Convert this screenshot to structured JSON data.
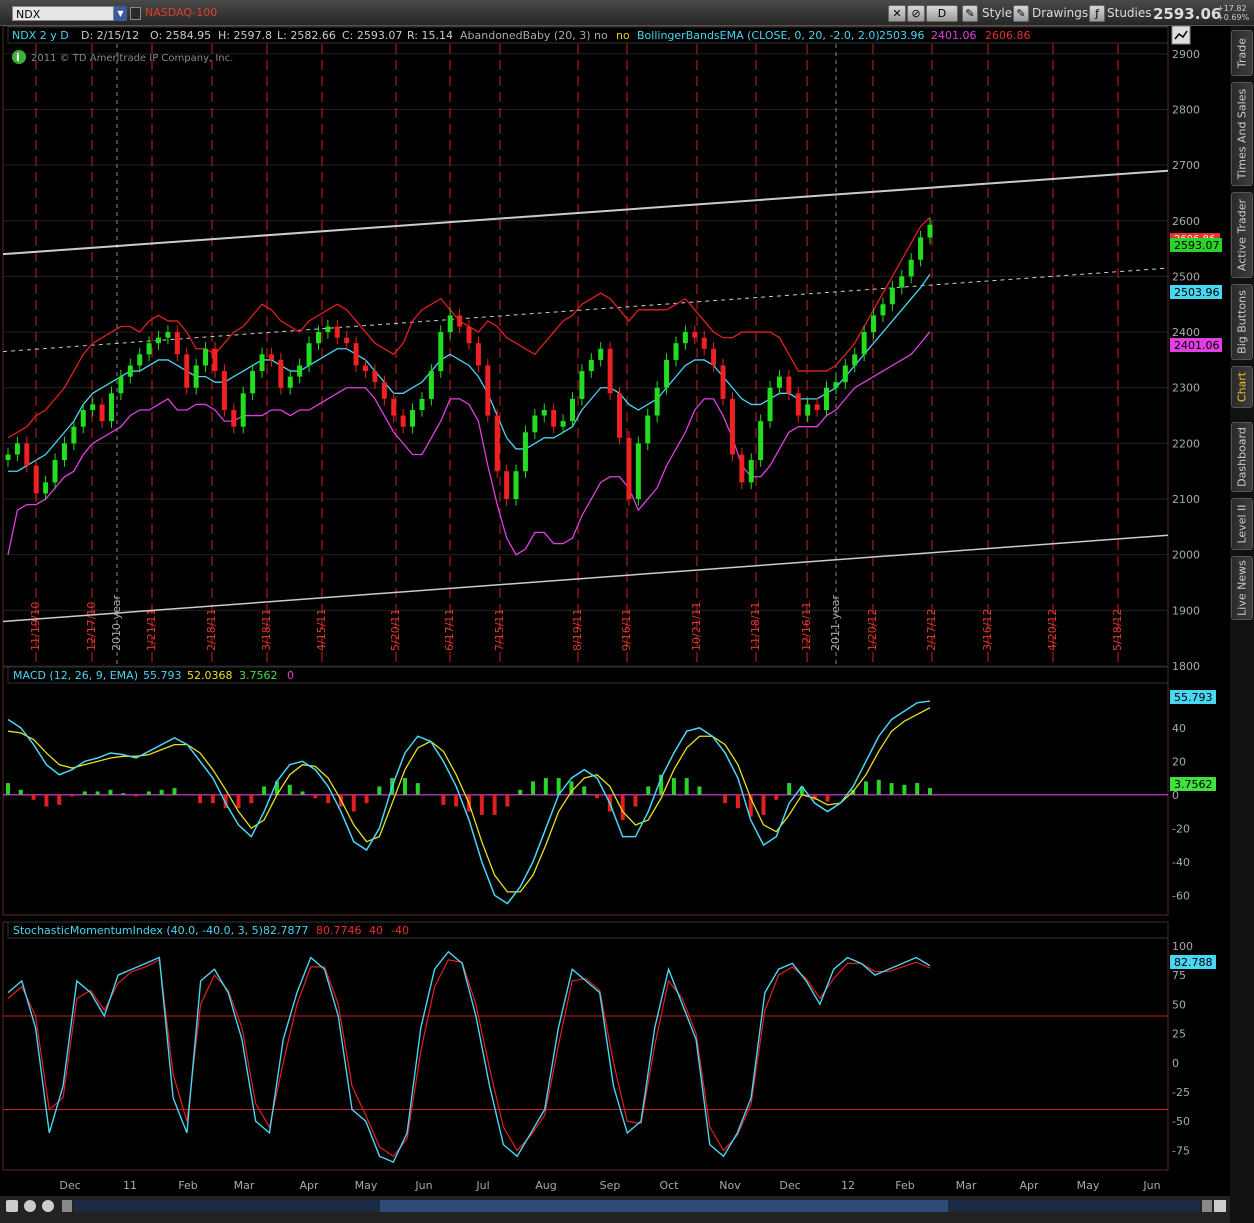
{
  "toolbar": {
    "symbol": "NDX",
    "symbol_desc": "NASDAQ-100",
    "aggregation": "D",
    "style_label": "Style",
    "drawings_label": "Drawings",
    "studies_label": "Studies",
    "last_price": "2593.06",
    "net_change": "+17.82",
    "net_change_pct": "+0.69%"
  },
  "sidebar": {
    "tabs": [
      "Trade",
      "Times And Sales",
      "Active Trader",
      "Big Buttons",
      "Chart",
      "Dashboard",
      "Level II",
      "Live News"
    ],
    "active": "Chart"
  },
  "price_header": {
    "symbol_period": "NDX 2 y D",
    "date": "D: 2/15/12",
    "open": "O: 2584.95",
    "high": "H: 2597.8",
    "low": "L: 2582.66",
    "close": "C: 2593.07",
    "range": "R: 15.14",
    "pattern": "AbandonedBaby (20, 3)",
    "pattern_val": "no",
    "pattern_val2": "no",
    "bb_label": "BollingerBandsEMA (CLOSE, 0, 20, -2.0, 2.0)",
    "bb_mid": "2503.96",
    "bb_low": "2401.06",
    "bb_up": "2606.86",
    "copyright": "2011 © TD Ameritrade IP Company, Inc.",
    "price_badge_close": "2593.07",
    "price_badge_mid": "2503.96",
    "price_badge_low": "2401.06",
    "price_badge_up": "2606.86"
  },
  "macd_header": {
    "label": "MACD (12, 26, 9, EMA)",
    "value": "55.793",
    "avg": "52.0368",
    "diff": "3.7562",
    "zero": "0",
    "badge_value": "55.793",
    "badge_diff": "3.7562"
  },
  "smi_header": {
    "label": "StochasticMomentumIndex (40.0, -40.0, 3, 5)",
    "smi": "82.7877",
    "avg": "80.7746",
    "over_bought": "40",
    "over_sold": "-40",
    "badge": "82.788"
  },
  "chart_data": [
    {
      "type": "candlestick",
      "title": "NDX 2 y D",
      "ylim": [
        1800,
        2950
      ],
      "y_ticks": [
        1800,
        1900,
        2000,
        2100,
        2200,
        2300,
        2400,
        2500,
        2600,
        2700,
        2800,
        2900
      ],
      "month_labels": [
        "Dec",
        "11",
        "Feb",
        "Mar",
        "Apr",
        "May",
        "Jun",
        "Jul",
        "Aug",
        "Sep",
        "Oct",
        "Nov",
        "Dec",
        "12",
        "Feb",
        "Mar",
        "Apr",
        "May",
        "Jun"
      ],
      "expiration_labels": [
        "11/19/10",
        "12/17/10",
        "2010 year",
        "1/21/11",
        "2/18/11",
        "3/18/11",
        "4/15/11",
        "5/20/11",
        "6/17/11",
        "7/15/11",
        "8/19/11",
        "9/16/11",
        "10/21/11",
        "11/18/11",
        "12/16/11",
        "2011 year",
        "1/20/12",
        "2/17/12",
        "3/16/12",
        "4/20/12",
        "5/18/12"
      ],
      "series": [
        {
          "name": "close",
          "values": [
            2180,
            2200,
            2160,
            2110,
            2130,
            2170,
            2200,
            2230,
            2260,
            2270,
            2240,
            2290,
            2320,
            2340,
            2360,
            2380,
            2390,
            2400,
            2360,
            2300,
            2340,
            2370,
            2330,
            2260,
            2230,
            2290,
            2330,
            2360,
            2350,
            2300,
            2320,
            2340,
            2380,
            2400,
            2410,
            2390,
            2380,
            2340,
            2330,
            2310,
            2280,
            2250,
            2230,
            2260,
            2280,
            2330,
            2400,
            2430,
            2410,
            2380,
            2340,
            2250,
            2150,
            2100,
            2150,
            2220,
            2250,
            2260,
            2230,
            2240,
            2280,
            2330,
            2350,
            2370,
            2290,
            2210,
            2100,
            2200,
            2250,
            2300,
            2350,
            2380,
            2400,
            2390,
            2370,
            2340,
            2280,
            2180,
            2130,
            2170,
            2240,
            2300,
            2320,
            2290,
            2250,
            2270,
            2260,
            2300,
            2310,
            2340,
            2360,
            2400,
            2430,
            2450,
            2480,
            2500,
            2530,
            2570,
            2593
          ]
        },
        {
          "name": "bb_upper",
          "values": [
            2210,
            2220,
            2230,
            2250,
            2260,
            2280,
            2300,
            2330,
            2360,
            2380,
            2390,
            2400,
            2410,
            2410,
            2400,
            2420,
            2430,
            2420,
            2420,
            2400,
            2370,
            2370,
            2360,
            2380,
            2400,
            2410,
            2430,
            2450,
            2440,
            2420,
            2410,
            2400,
            2420,
            2430,
            2440,
            2450,
            2440,
            2420,
            2400,
            2380,
            2370,
            2360,
            2380,
            2420,
            2440,
            2450,
            2460,
            2440,
            2420,
            2410,
            2400,
            2420,
            2410,
            2390,
            2380,
            2370,
            2360,
            2380,
            2400,
            2420,
            2430,
            2450,
            2460,
            2470,
            2460,
            2440,
            2420,
            2440,
            2440,
            2440,
            2440,
            2450,
            2460,
            2440,
            2420,
            2400,
            2390,
            2390,
            2400,
            2400,
            2400,
            2400,
            2390,
            2360,
            2330,
            2330,
            2330,
            2330,
            2340,
            2360,
            2380,
            2410,
            2440,
            2470,
            2500,
            2530,
            2560,
            2590,
            2606
          ]
        },
        {
          "name": "bb_mid",
          "values": [
            2150,
            2150,
            2160,
            2170,
            2180,
            2200,
            2220,
            2240,
            2270,
            2290,
            2300,
            2310,
            2320,
            2330,
            2330,
            2340,
            2350,
            2350,
            2340,
            2330,
            2320,
            2320,
            2310,
            2310,
            2320,
            2330,
            2340,
            2350,
            2350,
            2340,
            2330,
            2330,
            2340,
            2350,
            2360,
            2370,
            2370,
            2360,
            2350,
            2330,
            2310,
            2290,
            2290,
            2300,
            2310,
            2330,
            2350,
            2360,
            2350,
            2340,
            2320,
            2290,
            2250,
            2210,
            2190,
            2190,
            2200,
            2210,
            2210,
            2220,
            2230,
            2260,
            2280,
            2300,
            2300,
            2290,
            2270,
            2260,
            2270,
            2280,
            2300,
            2320,
            2340,
            2350,
            2350,
            2340,
            2320,
            2300,
            2280,
            2270,
            2270,
            2280,
            2290,
            2290,
            2280,
            2280,
            2280,
            2290,
            2300,
            2320,
            2340,
            2360,
            2380,
            2400,
            2420,
            2440,
            2460,
            2480,
            2504
          ]
        },
        {
          "name": "bb_lower",
          "values": [
            2000,
            2080,
            2090,
            2090,
            2100,
            2120,
            2140,
            2150,
            2180,
            2200,
            2210,
            2220,
            2230,
            2250,
            2260,
            2260,
            2270,
            2280,
            2260,
            2260,
            2270,
            2270,
            2260,
            2240,
            2240,
            2250,
            2250,
            2250,
            2260,
            2260,
            2250,
            2260,
            2260,
            2270,
            2280,
            2290,
            2300,
            2300,
            2300,
            2280,
            2250,
            2220,
            2200,
            2180,
            2180,
            2210,
            2240,
            2280,
            2280,
            2270,
            2240,
            2160,
            2090,
            2030,
            2000,
            2010,
            2040,
            2040,
            2020,
            2020,
            2030,
            2070,
            2100,
            2130,
            2140,
            2140,
            2120,
            2080,
            2100,
            2120,
            2160,
            2190,
            2220,
            2260,
            2280,
            2280,
            2250,
            2210,
            2160,
            2140,
            2140,
            2160,
            2190,
            2220,
            2230,
            2230,
            2230,
            2250,
            2260,
            2280,
            2300,
            2310,
            2320,
            2330,
            2340,
            2350,
            2360,
            2380,
            2401
          ]
        }
      ],
      "trendlines": [
        "upper channel",
        "midline",
        "lower channel"
      ]
    },
    {
      "type": "line",
      "title": "MACD (12, 26, 9, EMA)",
      "ylim": [
        -70,
        65
      ],
      "y_ticks": [
        -60,
        -40,
        -20,
        0,
        20,
        40
      ],
      "series": [
        {
          "name": "Value",
          "values": [
            45,
            40,
            30,
            18,
            12,
            15,
            20,
            22,
            25,
            24,
            22,
            26,
            30,
            34,
            30,
            20,
            10,
            -5,
            -18,
            -25,
            -10,
            8,
            18,
            20,
            15,
            5,
            -10,
            -28,
            -33,
            -20,
            5,
            25,
            35,
            32,
            20,
            5,
            -15,
            -40,
            -60,
            -65,
            -55,
            -40,
            -20,
            0,
            10,
            15,
            10,
            -5,
            -25,
            -25,
            -10,
            10,
            25,
            38,
            40,
            35,
            25,
            10,
            -15,
            -30,
            -25,
            -5,
            5,
            -5,
            -10,
            -5,
            5,
            20,
            35,
            45,
            50,
            55,
            56
          ]
        },
        {
          "name": "Avg",
          "values": [
            38,
            37,
            33,
            25,
            18,
            16,
            18,
            20,
            22,
            23,
            23,
            24,
            27,
            30,
            30,
            25,
            15,
            3,
            -10,
            -20,
            -15,
            0,
            12,
            18,
            17,
            10,
            -3,
            -18,
            -28,
            -25,
            -5,
            15,
            28,
            32,
            26,
            12,
            -5,
            -28,
            -48,
            -58,
            -58,
            -48,
            -30,
            -10,
            2,
            10,
            12,
            5,
            -10,
            -18,
            -15,
            -2,
            15,
            28,
            35,
            35,
            30,
            18,
            -2,
            -18,
            -22,
            -12,
            0,
            -2,
            -6,
            -5,
            2,
            12,
            26,
            38,
            44,
            48,
            52
          ]
        },
        {
          "name": "Diff",
          "values": [
            7,
            3,
            -3,
            -7,
            -6,
            -1,
            2,
            2,
            3,
            1,
            -1,
            2,
            3,
            4,
            0,
            -5,
            -5,
            -8,
            -8,
            -5,
            5,
            8,
            6,
            2,
            -2,
            -5,
            -7,
            -10,
            -5,
            5,
            10,
            10,
            7,
            0,
            -6,
            -7,
            -10,
            -12,
            -12,
            -7,
            3,
            8,
            10,
            10,
            8,
            5,
            -2,
            -10,
            -15,
            -7,
            5,
            12,
            10,
            10,
            5,
            0,
            -5,
            -8,
            -13,
            -12,
            -3,
            7,
            5,
            -3,
            -4,
            0,
            3,
            8,
            9,
            7,
            6,
            7,
            4
          ]
        }
      ]
    },
    {
      "type": "line",
      "title": "StochasticMomentumIndex (40.0, -40.0, 3, 5)",
      "ylim": [
        -90,
        105
      ],
      "y_ticks": [
        -75,
        -50,
        -25,
        0,
        25,
        50,
        75,
        100
      ],
      "series": [
        {
          "name": "SMI",
          "values": [
            60,
            70,
            30,
            -60,
            -20,
            70,
            60,
            40,
            75,
            80,
            85,
            90,
            -30,
            -60,
            70,
            80,
            60,
            20,
            -50,
            -60,
            20,
            60,
            90,
            80,
            40,
            -40,
            -50,
            -80,
            -85,
            -60,
            30,
            80,
            95,
            85,
            40,
            -20,
            -70,
            -80,
            -60,
            -40,
            30,
            80,
            70,
            60,
            -20,
            -60,
            -50,
            30,
            80,
            50,
            20,
            -70,
            -80,
            -60,
            -30,
            60,
            80,
            85,
            70,
            50,
            80,
            90,
            85,
            75,
            80,
            85,
            90,
            83
          ]
        },
        {
          "name": "AVG",
          "values": [
            55,
            65,
            40,
            -40,
            -30,
            55,
            62,
            45,
            68,
            78,
            82,
            88,
            -10,
            -50,
            50,
            75,
            62,
            30,
            -35,
            -55,
            0,
            50,
            82,
            82,
            50,
            -20,
            -45,
            -72,
            -80,
            -65,
            10,
            65,
            88,
            86,
            50,
            -5,
            -55,
            -75,
            -62,
            -45,
            15,
            70,
            72,
            62,
            0,
            -50,
            -52,
            15,
            70,
            55,
            25,
            -55,
            -75,
            -62,
            -35,
            45,
            75,
            82,
            72,
            55,
            72,
            85,
            85,
            78,
            78,
            82,
            86,
            81
          ]
        }
      ],
      "levels": [
        40,
        -40
      ]
    }
  ]
}
